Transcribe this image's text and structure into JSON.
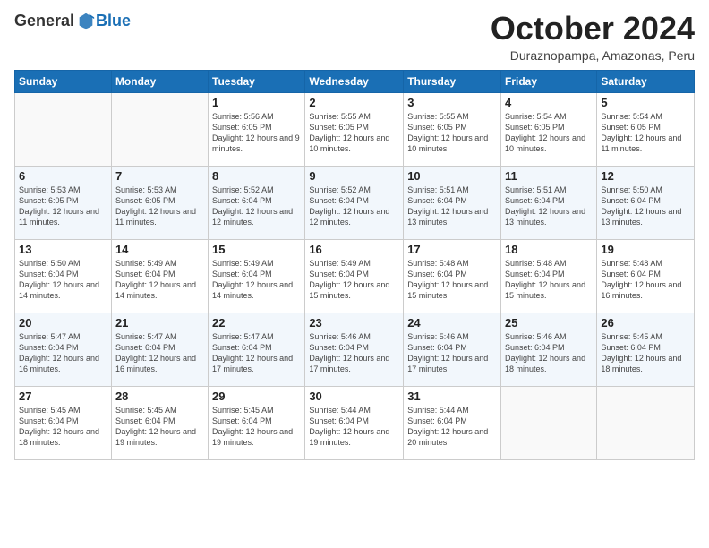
{
  "header": {
    "logo_general": "General",
    "logo_blue": "Blue",
    "month_title": "October 2024",
    "location": "Duraznopampa, Amazonas, Peru"
  },
  "days_of_week": [
    "Sunday",
    "Monday",
    "Tuesday",
    "Wednesday",
    "Thursday",
    "Friday",
    "Saturday"
  ],
  "weeks": [
    [
      {
        "day": "",
        "info": ""
      },
      {
        "day": "",
        "info": ""
      },
      {
        "day": "1",
        "info": "Sunrise: 5:56 AM\nSunset: 6:05 PM\nDaylight: 12 hours and 9 minutes."
      },
      {
        "day": "2",
        "info": "Sunrise: 5:55 AM\nSunset: 6:05 PM\nDaylight: 12 hours and 10 minutes."
      },
      {
        "day": "3",
        "info": "Sunrise: 5:55 AM\nSunset: 6:05 PM\nDaylight: 12 hours and 10 minutes."
      },
      {
        "day": "4",
        "info": "Sunrise: 5:54 AM\nSunset: 6:05 PM\nDaylight: 12 hours and 10 minutes."
      },
      {
        "day": "5",
        "info": "Sunrise: 5:54 AM\nSunset: 6:05 PM\nDaylight: 12 hours and 11 minutes."
      }
    ],
    [
      {
        "day": "6",
        "info": "Sunrise: 5:53 AM\nSunset: 6:05 PM\nDaylight: 12 hours and 11 minutes."
      },
      {
        "day": "7",
        "info": "Sunrise: 5:53 AM\nSunset: 6:05 PM\nDaylight: 12 hours and 11 minutes."
      },
      {
        "day": "8",
        "info": "Sunrise: 5:52 AM\nSunset: 6:04 PM\nDaylight: 12 hours and 12 minutes."
      },
      {
        "day": "9",
        "info": "Sunrise: 5:52 AM\nSunset: 6:04 PM\nDaylight: 12 hours and 12 minutes."
      },
      {
        "day": "10",
        "info": "Sunrise: 5:51 AM\nSunset: 6:04 PM\nDaylight: 12 hours and 13 minutes."
      },
      {
        "day": "11",
        "info": "Sunrise: 5:51 AM\nSunset: 6:04 PM\nDaylight: 12 hours and 13 minutes."
      },
      {
        "day": "12",
        "info": "Sunrise: 5:50 AM\nSunset: 6:04 PM\nDaylight: 12 hours and 13 minutes."
      }
    ],
    [
      {
        "day": "13",
        "info": "Sunrise: 5:50 AM\nSunset: 6:04 PM\nDaylight: 12 hours and 14 minutes."
      },
      {
        "day": "14",
        "info": "Sunrise: 5:49 AM\nSunset: 6:04 PM\nDaylight: 12 hours and 14 minutes."
      },
      {
        "day": "15",
        "info": "Sunrise: 5:49 AM\nSunset: 6:04 PM\nDaylight: 12 hours and 14 minutes."
      },
      {
        "day": "16",
        "info": "Sunrise: 5:49 AM\nSunset: 6:04 PM\nDaylight: 12 hours and 15 minutes."
      },
      {
        "day": "17",
        "info": "Sunrise: 5:48 AM\nSunset: 6:04 PM\nDaylight: 12 hours and 15 minutes."
      },
      {
        "day": "18",
        "info": "Sunrise: 5:48 AM\nSunset: 6:04 PM\nDaylight: 12 hours and 15 minutes."
      },
      {
        "day": "19",
        "info": "Sunrise: 5:48 AM\nSunset: 6:04 PM\nDaylight: 12 hours and 16 minutes."
      }
    ],
    [
      {
        "day": "20",
        "info": "Sunrise: 5:47 AM\nSunset: 6:04 PM\nDaylight: 12 hours and 16 minutes."
      },
      {
        "day": "21",
        "info": "Sunrise: 5:47 AM\nSunset: 6:04 PM\nDaylight: 12 hours and 16 minutes."
      },
      {
        "day": "22",
        "info": "Sunrise: 5:47 AM\nSunset: 6:04 PM\nDaylight: 12 hours and 17 minutes."
      },
      {
        "day": "23",
        "info": "Sunrise: 5:46 AM\nSunset: 6:04 PM\nDaylight: 12 hours and 17 minutes."
      },
      {
        "day": "24",
        "info": "Sunrise: 5:46 AM\nSunset: 6:04 PM\nDaylight: 12 hours and 17 minutes."
      },
      {
        "day": "25",
        "info": "Sunrise: 5:46 AM\nSunset: 6:04 PM\nDaylight: 12 hours and 18 minutes."
      },
      {
        "day": "26",
        "info": "Sunrise: 5:45 AM\nSunset: 6:04 PM\nDaylight: 12 hours and 18 minutes."
      }
    ],
    [
      {
        "day": "27",
        "info": "Sunrise: 5:45 AM\nSunset: 6:04 PM\nDaylight: 12 hours and 18 minutes."
      },
      {
        "day": "28",
        "info": "Sunrise: 5:45 AM\nSunset: 6:04 PM\nDaylight: 12 hours and 19 minutes."
      },
      {
        "day": "29",
        "info": "Sunrise: 5:45 AM\nSunset: 6:04 PM\nDaylight: 12 hours and 19 minutes."
      },
      {
        "day": "30",
        "info": "Sunrise: 5:44 AM\nSunset: 6:04 PM\nDaylight: 12 hours and 19 minutes."
      },
      {
        "day": "31",
        "info": "Sunrise: 5:44 AM\nSunset: 6:04 PM\nDaylight: 12 hours and 20 minutes."
      },
      {
        "day": "",
        "info": ""
      },
      {
        "day": "",
        "info": ""
      }
    ]
  ]
}
